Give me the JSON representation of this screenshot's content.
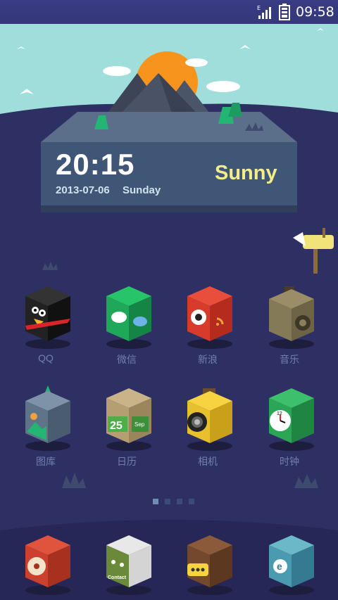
{
  "status": {
    "network": "E",
    "time": "09:58"
  },
  "widget": {
    "time": "20:15",
    "date": "2013-07-06",
    "day": "Sunday",
    "weather": "Sunny"
  },
  "apps": [
    {
      "label": "QQ",
      "icon": "qq-penguin-icon"
    },
    {
      "label": "微信",
      "icon": "wechat-icon"
    },
    {
      "label": "新浪",
      "icon": "weibo-icon"
    },
    {
      "label": "音乐",
      "icon": "music-speaker-icon"
    },
    {
      "label": "图库",
      "icon": "gallery-icon"
    },
    {
      "label": "日历",
      "icon": "calendar-icon"
    },
    {
      "label": "相机",
      "icon": "camera-icon"
    },
    {
      "label": "时钟",
      "icon": "clock-icon"
    }
  ],
  "calendar_icon": {
    "day": "25",
    "month": "Sep"
  },
  "pager": {
    "pages": 4,
    "current": 1
  },
  "dock": [
    {
      "icon": "phone-dialer-icon"
    },
    {
      "icon": "contacts-book-icon",
      "text": "Contact"
    },
    {
      "icon": "messages-icon"
    },
    {
      "icon": "browser-icon",
      "text": "e"
    }
  ],
  "colors": {
    "sky": "#9fdedb",
    "ground": "#2e2f63",
    "platform": "#3f5676",
    "accent": "#f3ec8a"
  }
}
